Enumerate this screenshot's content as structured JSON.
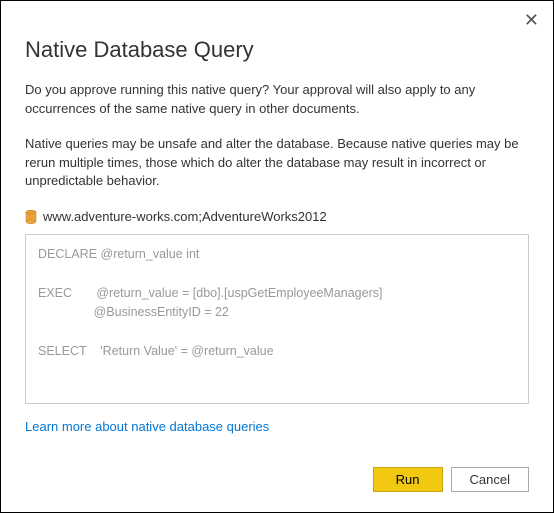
{
  "dialog": {
    "title": "Native Database Query",
    "approval_text": "Do you approve running this native query? Your approval will also apply to any occurrences of the same native query in other documents.",
    "warning_text": "Native queries may be unsafe and alter the database. Because native queries may be rerun multiple times, those which do alter the database may result in incorrect or unpredictable behavior.",
    "source": "www.adventure-works.com;AdventureWorks2012",
    "query_text": "DECLARE @return_value int\n\nEXEC       @return_value = [dbo].[uspGetEmployeeManagers]\n                @BusinessEntityID = 22\n\nSELECT    'Return Value' = @return_value",
    "learn_more_label": "Learn more about native database queries",
    "buttons": {
      "run": "Run",
      "cancel": "Cancel"
    }
  }
}
